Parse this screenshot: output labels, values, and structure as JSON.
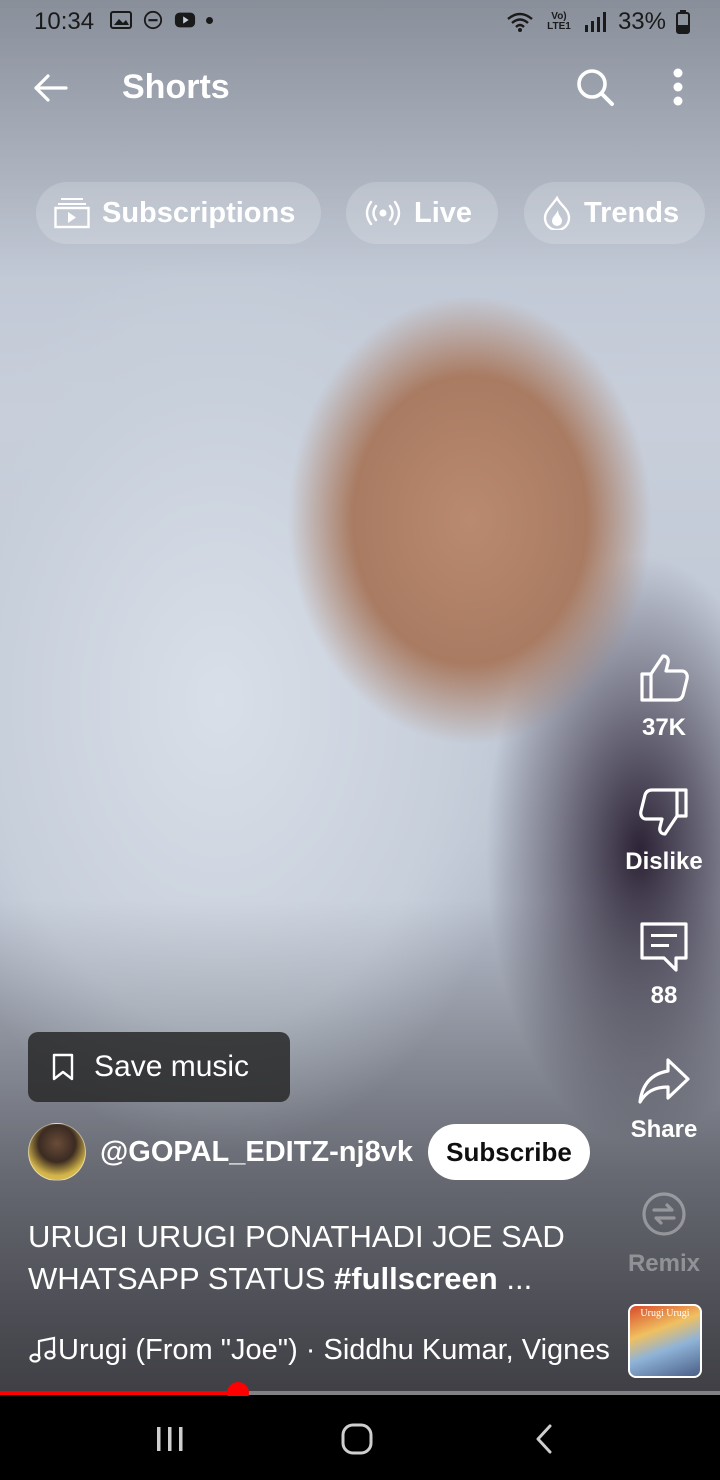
{
  "status_bar": {
    "time": "10:34",
    "network": "Vo) LTE1",
    "battery": "33%"
  },
  "appbar": {
    "title": "Shorts",
    "back_icon": "arrow-left-icon",
    "search_icon": "search-icon",
    "more_icon": "more-vert-icon"
  },
  "chips": [
    {
      "label": "Subscriptions",
      "icon": "subscriptions-icon"
    },
    {
      "label": "Live",
      "icon": "live-icon"
    },
    {
      "label": "Trends",
      "icon": "trending-icon"
    }
  ],
  "actions": {
    "like": {
      "label": "37K",
      "icon": "thumb-up-icon"
    },
    "dislike": {
      "label": "Dislike",
      "icon": "thumb-down-icon"
    },
    "comments": {
      "label": "88",
      "icon": "comment-icon"
    },
    "share": {
      "label": "Share",
      "icon": "share-icon"
    },
    "remix": {
      "label": "Remix",
      "icon": "remix-icon"
    }
  },
  "save_music": {
    "label": "Save music",
    "icon": "bookmark-icon"
  },
  "channel": {
    "handle": "@GOPAL_EDITZ-nj8vk",
    "subscribe_label": "Subscribe"
  },
  "video": {
    "title_text": "URUGI URUGI PONATHADI JOE SAD WHATSAPP STATUS ",
    "hashtag": "#fullscreen",
    "ellipsis": " ...",
    "music": "Urugi (From \"Joe\") · Siddhu Kumar, Vignesh Ramakrishna",
    "music_thumb_label": "Urugi Urugi",
    "progress": 0.33
  },
  "colors": {
    "accent": "#ff0000",
    "subscribe_bg": "#ffffff"
  }
}
